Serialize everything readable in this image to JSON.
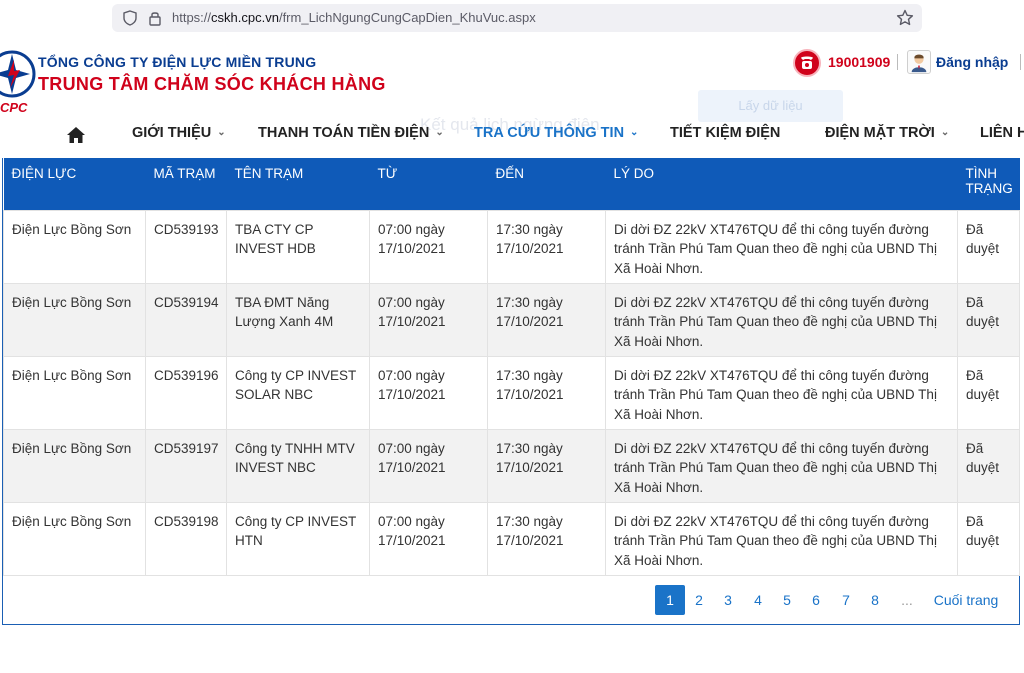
{
  "browser": {
    "url_prefix": "https://",
    "url_host": "cskh.cpc.vn",
    "url_path": "/frm_LichNgungCungCapDien_KhuVuc.aspx"
  },
  "header": {
    "company_line1": "TỔNG CÔNG TY ĐIỆN LỰC MIỀN TRUNG",
    "company_line2": "TRUNG TÂM CHĂM SÓC KHÁCH HÀNG",
    "logo_text": "CPC",
    "ghost_button": "Lấy dữ liệu",
    "hotline": "19001909",
    "login": "Đăng nhập"
  },
  "nav": {
    "items": [
      {
        "label": "GIỚI THIỆU",
        "has_dropdown": true
      },
      {
        "label": "THANH TOÁN TIỀN ĐIỆN",
        "has_dropdown": true
      },
      {
        "label": "TRA CỨU THÔNG TIN",
        "has_dropdown": true,
        "active": true
      },
      {
        "label": "TIẾT KIỆM ĐIỆN",
        "has_dropdown": false
      },
      {
        "label": "ĐIỆN MẶT TRỜI",
        "has_dropdown": true
      },
      {
        "label": "LIÊN H",
        "has_dropdown": false
      }
    ],
    "ghost_title": "Kết quả lịch ngừng điện"
  },
  "table": {
    "headers": [
      "ĐIỆN LỰC",
      "MÃ TRẠM",
      "TÊN TRẠM",
      "TỪ",
      "ĐẾN",
      "LÝ DO",
      "TÌNH TRẠNG"
    ],
    "rows": [
      [
        "Điện Lực Bồng Sơn",
        "CD539193",
        "TBA CTY CP INVEST HDB",
        "07:00 ngày 17/10/2021",
        "17:30 ngày 17/10/2021",
        "Di dời ĐZ 22kV XT476TQU để thi công tuyến đường tránh Trần Phú Tam Quan theo đề nghị của UBND Thị Xã Hoài Nhơn.",
        "Đã duyệt"
      ],
      [
        "Điện Lực Bồng Sơn",
        "CD539194",
        "TBA ĐMT Năng Lượng Xanh 4M",
        "07:00 ngày 17/10/2021",
        "17:30 ngày 17/10/2021",
        "Di dời ĐZ 22kV XT476TQU để thi công tuyến đường tránh Trần Phú Tam Quan theo đề nghị của UBND Thị Xã Hoài Nhơn.",
        "Đã duyệt"
      ],
      [
        "Điện Lực Bồng Sơn",
        "CD539196",
        "Công ty CP INVEST SOLAR NBC",
        "07:00 ngày 17/10/2021",
        "17:30 ngày 17/10/2021",
        "Di dời ĐZ 22kV XT476TQU để thi công tuyến đường tránh Trần Phú Tam Quan theo đề nghị của UBND Thị Xã Hoài Nhơn.",
        "Đã duyệt"
      ],
      [
        "Điện Lực Bồng Sơn",
        "CD539197",
        "Công ty TNHH MTV INVEST NBC",
        "07:00 ngày 17/10/2021",
        "17:30 ngày 17/10/2021",
        "Di dời ĐZ 22kV XT476TQU để thi công tuyến đường tránh Trần Phú Tam Quan theo đề nghị của UBND Thị Xã Hoài Nhơn.",
        "Đã duyệt"
      ],
      [
        "Điện Lực Bồng Sơn",
        "CD539198",
        "Công ty CP INVEST HTN",
        "07:00 ngày 17/10/2021",
        "17:30 ngày 17/10/2021",
        "Di dời ĐZ 22kV XT476TQU để thi công tuyến đường tránh Trần Phú Tam Quan theo đề nghị của UBND Thị Xã Hoài Nhơn.",
        "Đã duyệt"
      ]
    ]
  },
  "pagination": {
    "pages": [
      "1",
      "2",
      "3",
      "4",
      "5",
      "6",
      "7",
      "8"
    ],
    "current": "1",
    "ellipsis": "...",
    "last_label": "Cuối trang"
  },
  "colors": {
    "brand_blue": "#0a3d91",
    "brand_red": "#d0021b",
    "header_bg": "#0f5ab8",
    "link_blue": "#1a73c8"
  }
}
